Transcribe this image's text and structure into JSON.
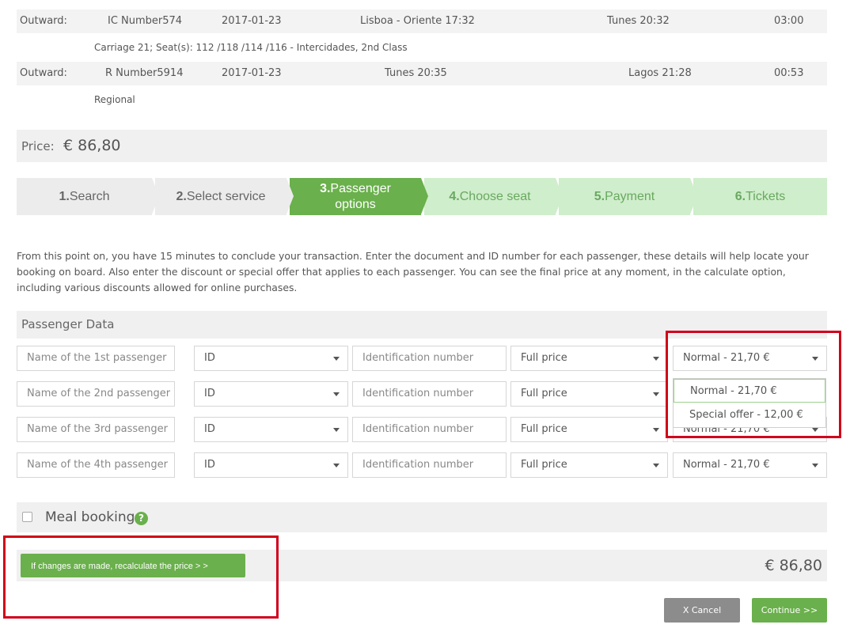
{
  "journeys": [
    {
      "direction": "Outward:",
      "train": "IC Number574",
      "date": "2017-01-23",
      "from": "Lisboa - Oriente 17:32",
      "to": "Tunes 20:32",
      "duration": "03:00",
      "details": "Carriage 21; Seat(s): 112 /118 /114 /116  -  Intercidades, 2nd Class"
    },
    {
      "direction": "Outward:",
      "train": "R Number5914",
      "date": "2017-01-23",
      "from": "Tunes 20:35",
      "to": "Lagos 21:28",
      "duration": "00:53",
      "details": "Regional"
    }
  ],
  "price": {
    "label": "Price:",
    "value": "€ 86,80"
  },
  "steps": [
    {
      "num": "1.",
      "label": "Search"
    },
    {
      "num": "2.",
      "label": "Select service"
    },
    {
      "num": "3.",
      "label": "Passenger options"
    },
    {
      "num": "4.",
      "label": "Choose seat"
    },
    {
      "num": "5.",
      "label": "Payment"
    },
    {
      "num": "6.",
      "label": "Tickets"
    }
  ],
  "intro": "From this point on, you have 15 minutes to conclude your transaction. Enter the document and ID number for each passenger, these details will help locate your booking on board. Also enter the discount or special offer that applies to each passenger. You can see the final price at any moment, in the calculate option, including various discounts allowed for online purchases.",
  "passenger_data": {
    "title": "Passenger Data",
    "rows": [
      {
        "name_placeholder": "Name of the 1st passenger",
        "doc": "ID",
        "id_placeholder": "Identification number",
        "fare": "Full price",
        "offer": "Normal - 21,70 €"
      },
      {
        "name_placeholder": "Name of the 2nd passenger",
        "doc": "ID",
        "id_placeholder": "Identification number",
        "fare": "Full price",
        "offer": "Normal - 21,70 €"
      },
      {
        "name_placeholder": "Name of the 3rd passenger",
        "doc": "ID",
        "id_placeholder": "Identification number",
        "fare": "Full price",
        "offer": "Normal - 21,70 €"
      },
      {
        "name_placeholder": "Name of the 4th passenger",
        "doc": "ID",
        "id_placeholder": "Identification number",
        "fare": "Full price",
        "offer": "Normal - 21,70 €"
      }
    ],
    "offer_options": [
      "Normal - 21,70 €",
      "Special offer - 12,00 €"
    ]
  },
  "meal": {
    "label": "Meal booking",
    "help": "?"
  },
  "recalc_label": "If changes are made, recalculate the price > >",
  "total": "€ 86,80",
  "cancel_label": "X Cancel",
  "continue_label": "Continue >>",
  "colors": {
    "accent": "#6ab04c",
    "step_todo_bg": "#cfeecb",
    "highlight_box": "#d0021b"
  }
}
